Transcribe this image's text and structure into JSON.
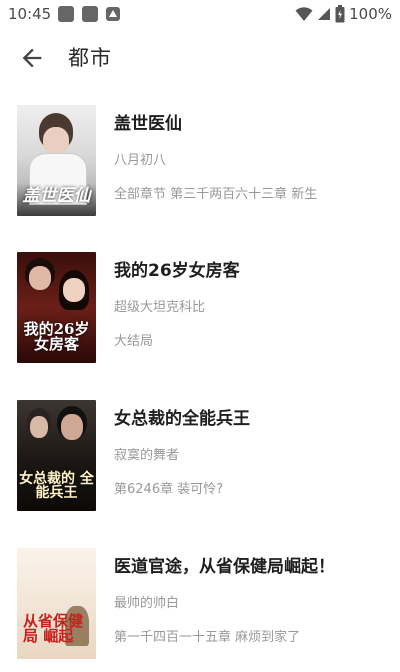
{
  "status_bar": {
    "time": "10:45",
    "battery": "100%",
    "icons": [
      "notification-icon",
      "notification-icon",
      "app-icon",
      "wifi-icon",
      "signal-icon",
      "battery-icon"
    ]
  },
  "header": {
    "title": "都市",
    "back_icon": "arrow-back-icon"
  },
  "books": [
    {
      "title": "盖世医仙",
      "author": "八月初八",
      "latest": "全部章节 第三千两百六十三章  新生",
      "cover_text": "盖世医仙",
      "cover_color": "#dcdcdc"
    },
    {
      "title": "我的26岁女房客",
      "author": "超级大坦克科比",
      "latest": "大结局",
      "cover_text": "我的26岁 女房客",
      "cover_color": "#5a1e1a"
    },
    {
      "title": "女总裁的全能兵王",
      "author": "寂寞的舞者",
      "latest": "第6246章 装可怜?",
      "cover_text": "女总裁的 全能兵王",
      "cover_color": "#2b2420"
    },
    {
      "title": "医道官途，从省保健局崛起！",
      "author": "最帅的帅白",
      "latest": "第一千四百一十五章 麻烦到家了",
      "cover_text": "从省保健局 崛起",
      "cover_color": "#f2e7dc"
    }
  ]
}
